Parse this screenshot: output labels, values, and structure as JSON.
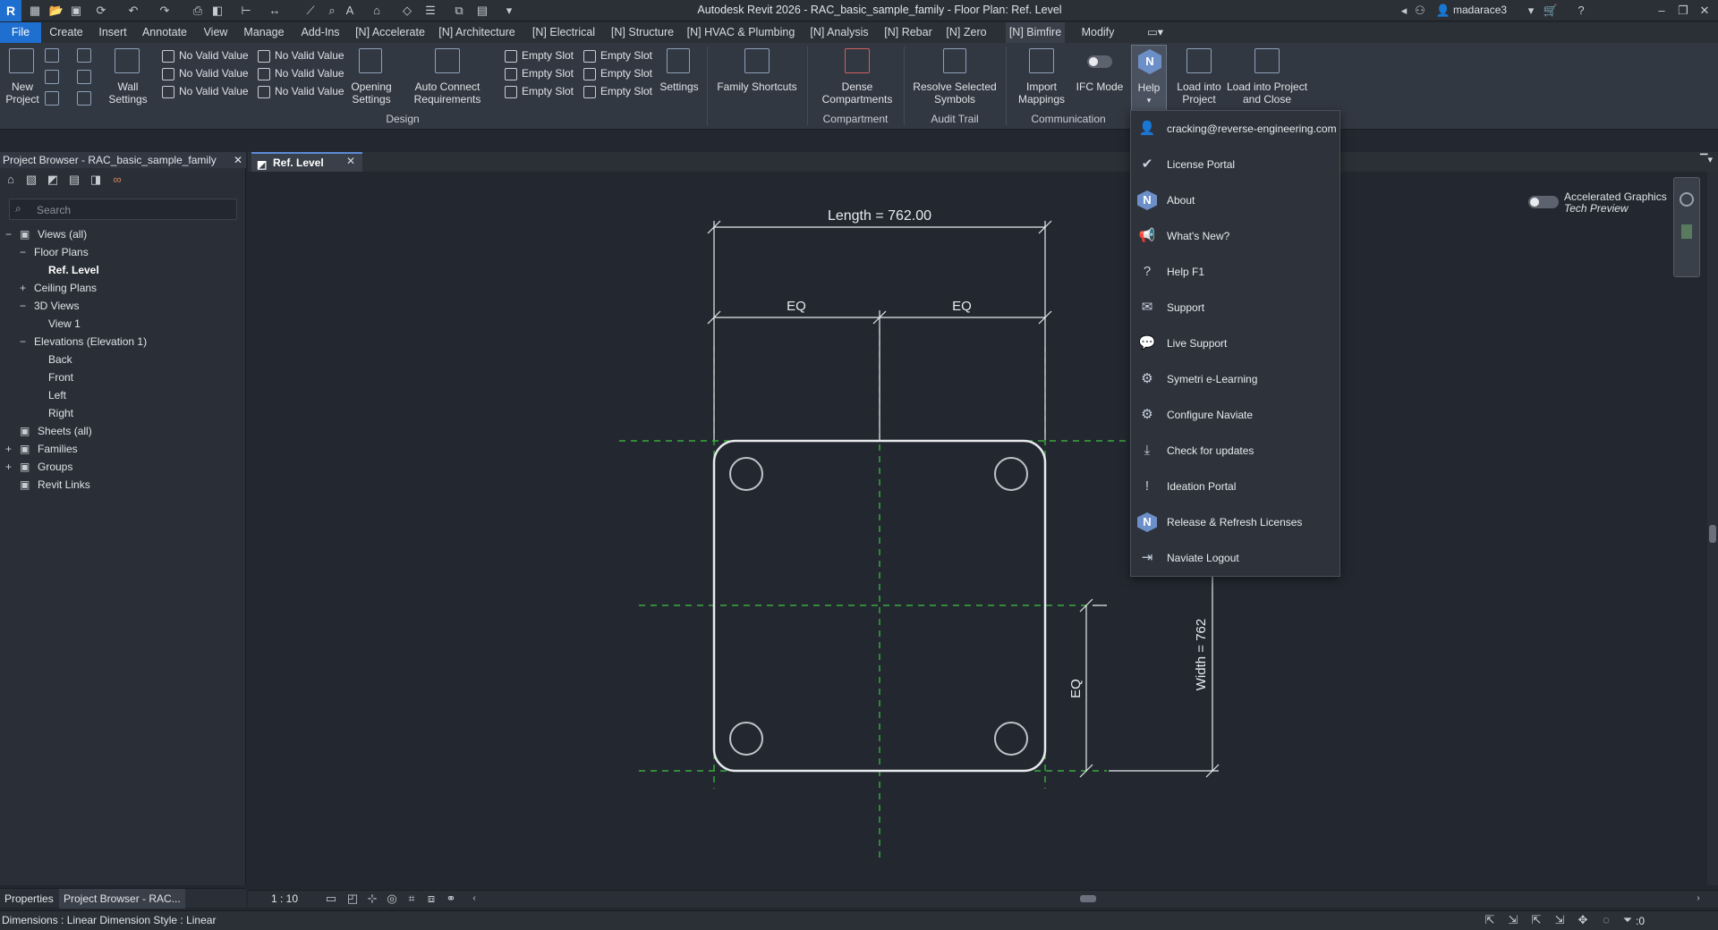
{
  "window": {
    "title": "Autodesk Revit 2026 - RAC_basic_sample_family - Floor Plan: Ref. Level",
    "user": "madarace3",
    "app_logo": "R"
  },
  "tabs": [
    "File",
    "Create",
    "Insert",
    "Annotate",
    "View",
    "Manage",
    "Add-Ins",
    "[N] Accelerate",
    "[N] Architecture",
    "[N] Electrical",
    "[N] Structure",
    "[N] HVAC & Plumbing",
    "[N] Analysis",
    "[N] Rebar",
    "[N] Zero",
    "[N] Bimfire",
    "Modify"
  ],
  "ribbon": {
    "new_project": "New Project",
    "wall_settings": "Wall Settings",
    "no_valid_value": "No Valid Value",
    "opening_settings": "Opening Settings",
    "auto_connect": "Auto Connect Requirements",
    "empty_slot": "Empty Slot",
    "settings": "Settings",
    "family_shortcuts": "Family Shortcuts",
    "dense_compartments": "Dense Compartments",
    "resolve_selected_symbols": "Resolve Selected Symbols",
    "import_mappings": "Import Mappings",
    "ifc_mode": "IFC Mode",
    "help": "Help",
    "load_into_project": "Load into Project",
    "load_into_project_close": "Load into Project and Close",
    "panels": {
      "design": "Design",
      "compartment": "Compartment",
      "audit_trail": "Audit Trail",
      "communication": "Communication"
    }
  },
  "help_menu": {
    "items": [
      {
        "label": "cracking@reverse-engineering.com",
        "icon": "user-icon"
      },
      {
        "label": "License Portal",
        "icon": "badge-icon"
      },
      {
        "label": "About",
        "icon": "naviate-icon"
      },
      {
        "label": "What's New?",
        "icon": "megaphone-icon"
      },
      {
        "label": "Help F1",
        "icon": "question-icon"
      },
      {
        "label": "Support",
        "icon": "mail-icon"
      },
      {
        "label": "Live Support",
        "icon": "chat-icon"
      },
      {
        "label": "Symetri e-Learning",
        "icon": "elearning-icon"
      },
      {
        "label": "Configure Naviate",
        "icon": "gear-icon"
      },
      {
        "label": "Check for updates",
        "icon": "download-icon"
      },
      {
        "label": "Ideation Portal",
        "icon": "lightbulb-icon"
      },
      {
        "label": "Release & Refresh Licenses",
        "icon": "naviate-icon"
      },
      {
        "label": "Naviate Logout",
        "icon": "logout-icon"
      }
    ]
  },
  "project_browser": {
    "title": "Project Browser - RAC_basic_sample_family",
    "search_placeholder": "Search",
    "tree": [
      {
        "label": "Views (all)",
        "level": 0,
        "toggle": "−"
      },
      {
        "label": "Floor Plans",
        "level": 1,
        "toggle": "−"
      },
      {
        "label": "Ref. Level",
        "level": 2,
        "toggle": "",
        "bold": true
      },
      {
        "label": "Ceiling Plans",
        "level": 1,
        "toggle": "+"
      },
      {
        "label": "3D Views",
        "level": 1,
        "toggle": "−"
      },
      {
        "label": "View 1",
        "level": 2,
        "toggle": ""
      },
      {
        "label": "Elevations (Elevation 1)",
        "level": 1,
        "toggle": "−"
      },
      {
        "label": "Back",
        "level": 2,
        "toggle": ""
      },
      {
        "label": "Front",
        "level": 2,
        "toggle": ""
      },
      {
        "label": "Left",
        "level": 2,
        "toggle": ""
      },
      {
        "label": "Right",
        "level": 2,
        "toggle": ""
      },
      {
        "label": "Sheets (all)",
        "level": 0,
        "toggle": ""
      },
      {
        "label": "Families",
        "level": 0,
        "toggle": "+"
      },
      {
        "label": "Groups",
        "level": 0,
        "toggle": "+"
      },
      {
        "label": "Revit Links",
        "level": 0,
        "toggle": ""
      }
    ],
    "bottom_tabs": [
      "Properties",
      "Project Browser - RAC..."
    ]
  },
  "view_tab": {
    "label": "Ref. Level"
  },
  "drawing": {
    "length_label": "Length = 762.00",
    "width_label": "Width = 762",
    "eq": "EQ"
  },
  "accelerated_graphics": {
    "line1": "Accelerated Graphics",
    "line2": "Tech Preview"
  },
  "view_control": {
    "scale": "1 : 10"
  },
  "status": {
    "text": "Dimensions : Linear Dimension Style : Linear",
    "filter_count": ":0"
  }
}
